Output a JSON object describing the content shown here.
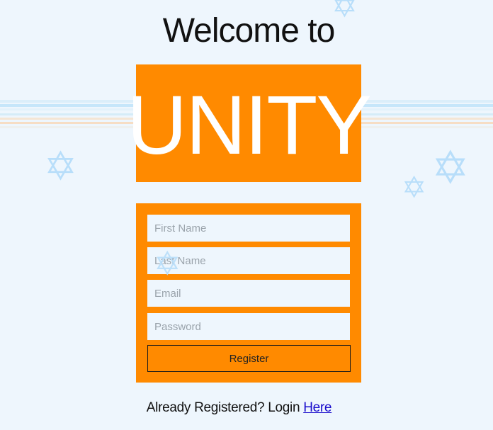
{
  "page": {
    "welcome_text": "Welcome to",
    "brand": "UNITY",
    "colors": {
      "accent": "#ff8a00",
      "background": "#eef6fd",
      "input_background": "#eef6fd",
      "link": "#1a0dcc",
      "decoration": "#b8defa"
    }
  },
  "form": {
    "first_name_placeholder": "First Name",
    "last_name_placeholder": "Last Name",
    "email_placeholder": "Email",
    "password_placeholder": "Password",
    "register_label": "Register"
  },
  "footer": {
    "prompt": "Already Registered? Login ",
    "link_label": "Here"
  },
  "decorations": {
    "star_icon": "star-of-david-icon"
  }
}
